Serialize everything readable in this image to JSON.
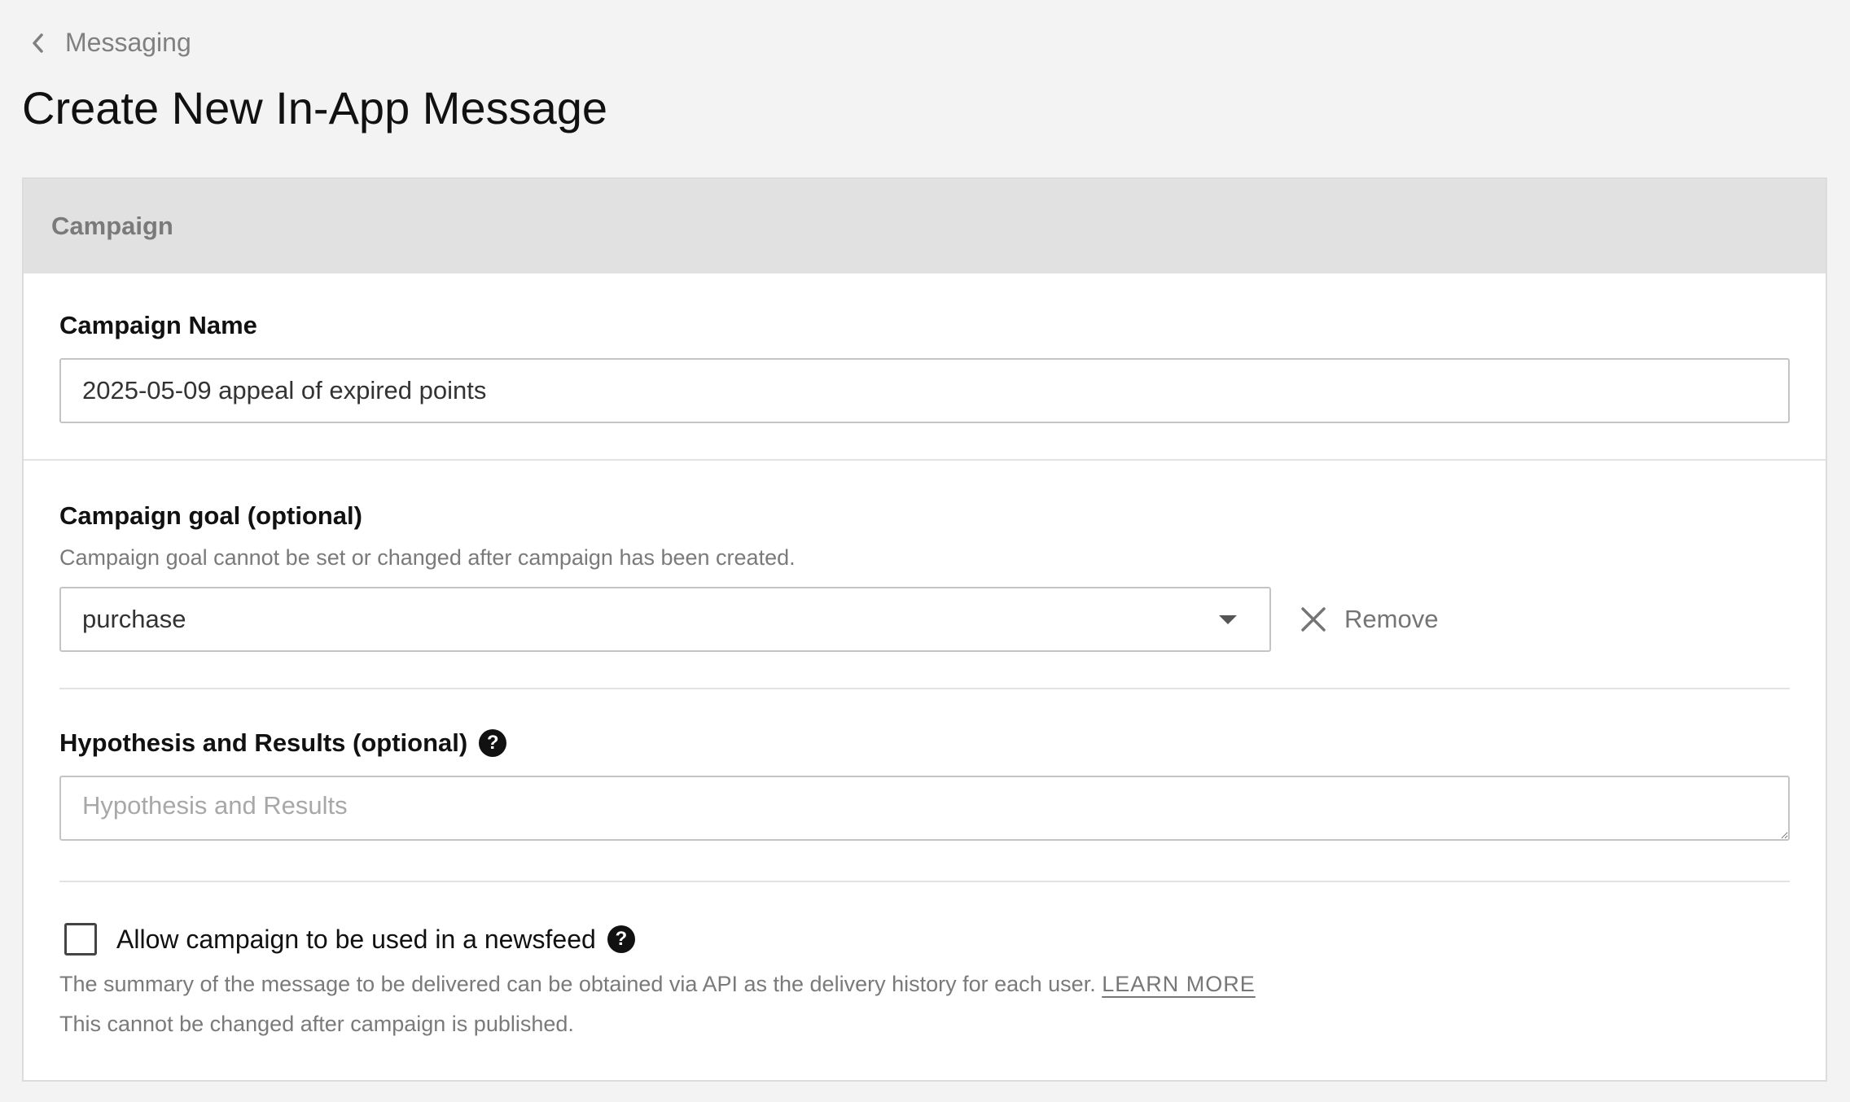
{
  "breadcrumb": {
    "label": "Messaging",
    "icon": "chevron-left-icon"
  },
  "page": {
    "title": "Create New In-App Message"
  },
  "card": {
    "header": "Campaign"
  },
  "campaign_name": {
    "label": "Campaign Name",
    "value": "2025-05-09 appeal of expired points"
  },
  "campaign_goal": {
    "label": "Campaign goal (optional)",
    "hint": "Campaign goal cannot be set or changed after campaign has been created.",
    "selected": "purchase",
    "remove_label": "Remove"
  },
  "hypothesis": {
    "label": "Hypothesis and Results (optional)",
    "placeholder": "Hypothesis and Results",
    "help_icon": "?"
  },
  "newsfeed": {
    "checkbox_label": "Allow campaign to be used in a newsfeed",
    "checked": false,
    "help_icon": "?",
    "description": "The summary of the message to be delivered can be obtained via API as the delivery history for each user.",
    "learn_more": "LEARN MORE",
    "note": "This cannot be changed after campaign is published."
  },
  "colors": {
    "background": "#f3f3f3",
    "card_header": "#e1e1e1",
    "muted_text": "#7a7a7a",
    "border": "#c4c4c4"
  }
}
